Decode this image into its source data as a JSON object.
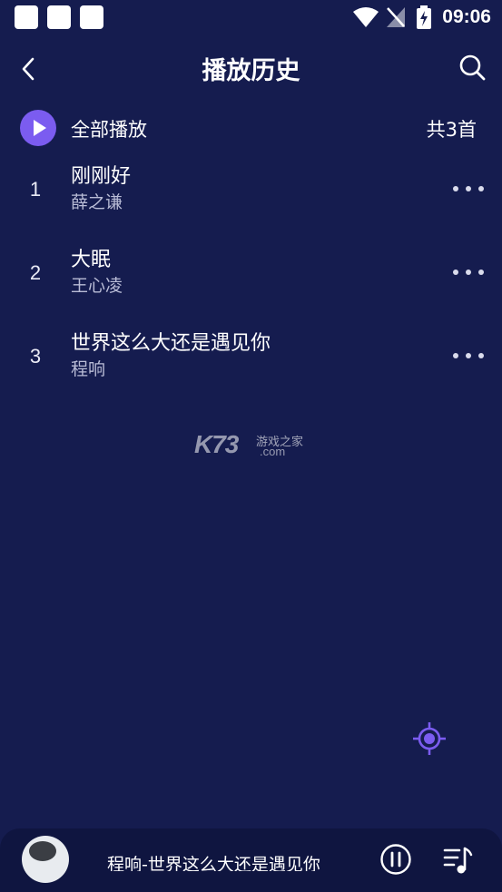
{
  "status_bar": {
    "time": "09:06"
  },
  "header": {
    "title": "播放历史"
  },
  "play_all": {
    "label": "全部播放",
    "count": "共3首"
  },
  "songs": [
    {
      "no": "1",
      "title": "刚刚好",
      "artist": "薛之谦"
    },
    {
      "no": "2",
      "title": "大眠",
      "artist": "王心凌"
    },
    {
      "no": "3",
      "title": "世界这么大还是遇见你",
      "artist": "程响"
    }
  ],
  "watermark": {
    "brand": "K73",
    "tagline": "游戏之家",
    "domain": ".com"
  },
  "player": {
    "now_playing": "程响-世界这么大还是遇见你"
  },
  "colors": {
    "background": "#151c4f",
    "accent": "#7b5cf0",
    "player_bg": "#0f1540"
  }
}
